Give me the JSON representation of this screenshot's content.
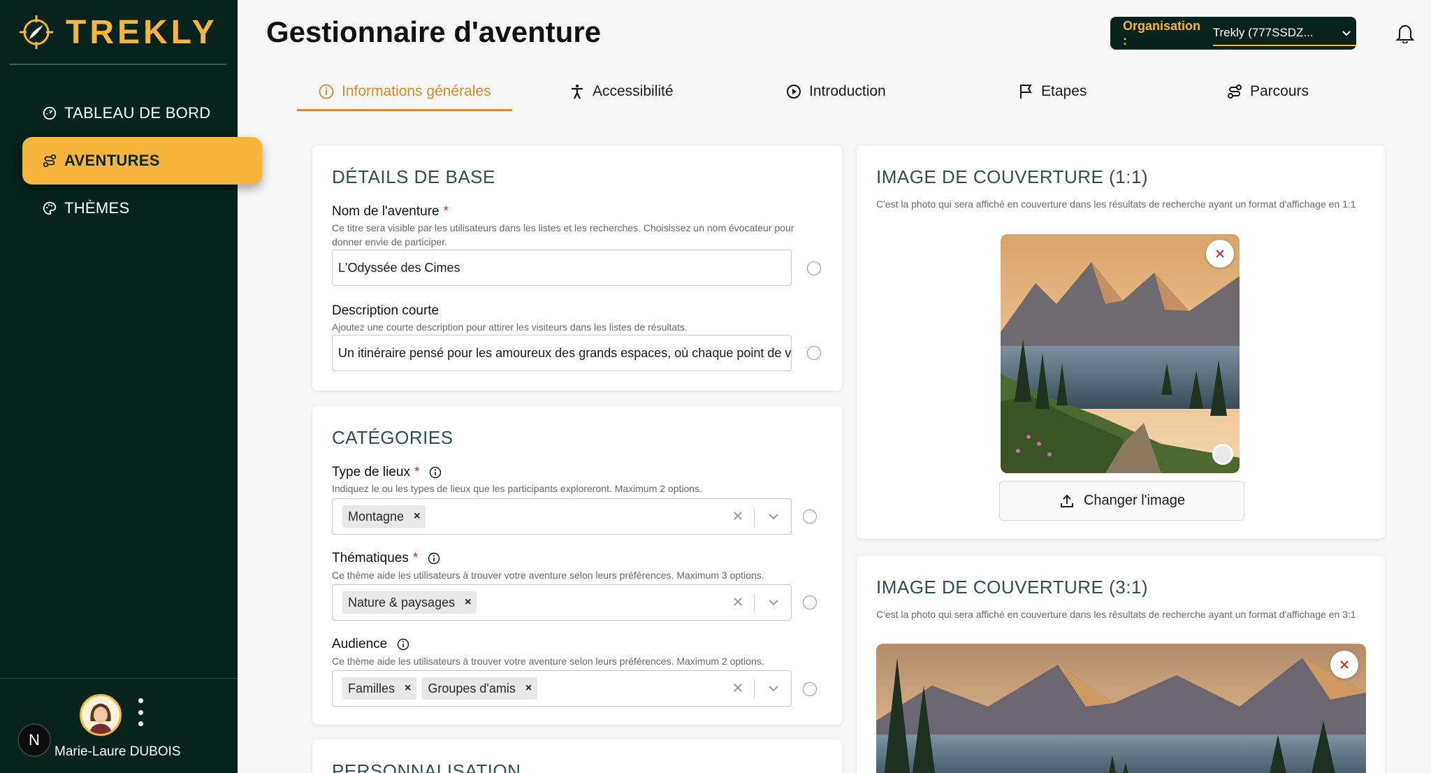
{
  "app": {
    "brand": "TREKLY",
    "page_title": "Gestionnaire d'aventure"
  },
  "sidebar": {
    "items": [
      {
        "label": "TABLEAU DE BORD",
        "icon": "dashboard-icon",
        "active": false
      },
      {
        "label": "AVENTURES",
        "icon": "route-icon",
        "active": true
      },
      {
        "label": "THÈMES",
        "icon": "palette-icon",
        "active": false
      }
    ],
    "user": {
      "name": "Marie-Laure DUBOIS",
      "badge": "N"
    }
  },
  "header": {
    "org_label": "Organisation :",
    "org_value": "Trekly (777SSDZ..."
  },
  "tabs": [
    {
      "label": "Informations générales",
      "icon": "info-icon",
      "active": true
    },
    {
      "label": "Accessibilité",
      "icon": "accessibility-icon",
      "active": false
    },
    {
      "label": "Introduction",
      "icon": "play-icon",
      "active": false
    },
    {
      "label": "Etapes",
      "icon": "flag-icon",
      "active": false
    },
    {
      "label": "Parcours",
      "icon": "route-icon",
      "active": false
    }
  ],
  "details": {
    "title": "DÉTAILS DE BASE",
    "name_label": "Nom de l'aventure",
    "name_help": "Ce titre sera visible par les utilisateurs dans les listes et les recherches. Choisissez un nom évocateur pour donner envie de participer.",
    "name_value": "L'Odyssée des Cimes",
    "short_desc_label": "Description courte",
    "short_desc_help": "Ajoutez une courte description pour attirer les visiteurs dans les listes de résultats.",
    "short_desc_value": "Un itinéraire pensé pour les amoureux des grands espaces, où chaque point de vue"
  },
  "categories": {
    "title": "CATÉGORIES",
    "place_label": "Type de lieux",
    "place_help": "Indiquez le ou les types de lieux que les participants exploreront. Maximum 2 options.",
    "place_chips": [
      "Montagne"
    ],
    "theme_label": "Thématiques",
    "theme_help": "Ce thème aide les utilisateurs à trouver votre aventure selon leurs préférences. Maximum 3 options.",
    "theme_chips": [
      "Nature & paysages"
    ],
    "audience_label": "Audience",
    "audience_help": "Ce thème aide les utilisateurs à trouver votre aventure selon leurs préférences. Maximum 2 options.",
    "audience_chips": [
      "Familles",
      "Groupes d'amis"
    ]
  },
  "personalisation": {
    "title": "PERSONNALISATION"
  },
  "cover_square": {
    "title": "IMAGE DE COUVERTURE (1:1)",
    "help": "C'est la photo qui sera affiché en couverture dans les résultats de recherche ayant un format d'affichage en 1:1",
    "change_label": "Changer l'image"
  },
  "cover_wide": {
    "title": "IMAGE DE COUVERTURE (3:1)",
    "help": "C'est la photo qui sera affiché en couverture dans les résultats de recherche ayant un format d'affichage en 3:1"
  },
  "colors": {
    "accent": "#f7b53c",
    "sidebar": "#07231b",
    "tab_active": "#d98a2e"
  }
}
